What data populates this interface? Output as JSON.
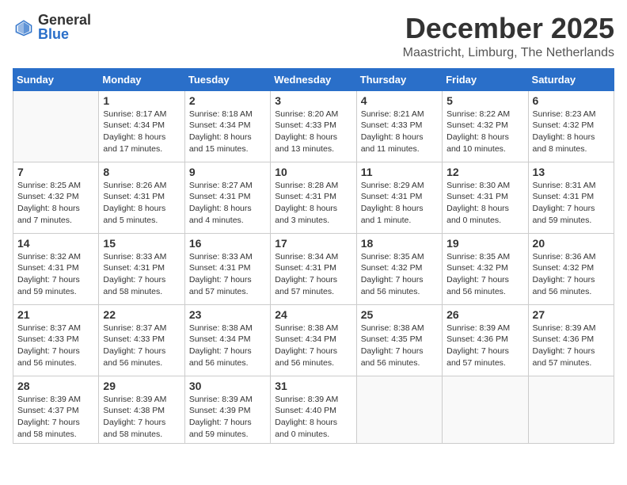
{
  "logo": {
    "general": "General",
    "blue": "Blue"
  },
  "title": "December 2025",
  "location": "Maastricht, Limburg, The Netherlands",
  "weekdays": [
    "Sunday",
    "Monday",
    "Tuesday",
    "Wednesday",
    "Thursday",
    "Friday",
    "Saturday"
  ],
  "weeks": [
    [
      {
        "day": "",
        "info": ""
      },
      {
        "day": "1",
        "info": "Sunrise: 8:17 AM\nSunset: 4:34 PM\nDaylight: 8 hours\nand 17 minutes."
      },
      {
        "day": "2",
        "info": "Sunrise: 8:18 AM\nSunset: 4:34 PM\nDaylight: 8 hours\nand 15 minutes."
      },
      {
        "day": "3",
        "info": "Sunrise: 8:20 AM\nSunset: 4:33 PM\nDaylight: 8 hours\nand 13 minutes."
      },
      {
        "day": "4",
        "info": "Sunrise: 8:21 AM\nSunset: 4:33 PM\nDaylight: 8 hours\nand 11 minutes."
      },
      {
        "day": "5",
        "info": "Sunrise: 8:22 AM\nSunset: 4:32 PM\nDaylight: 8 hours\nand 10 minutes."
      },
      {
        "day": "6",
        "info": "Sunrise: 8:23 AM\nSunset: 4:32 PM\nDaylight: 8 hours\nand 8 minutes."
      }
    ],
    [
      {
        "day": "7",
        "info": "Sunrise: 8:25 AM\nSunset: 4:32 PM\nDaylight: 8 hours\nand 7 minutes."
      },
      {
        "day": "8",
        "info": "Sunrise: 8:26 AM\nSunset: 4:31 PM\nDaylight: 8 hours\nand 5 minutes."
      },
      {
        "day": "9",
        "info": "Sunrise: 8:27 AM\nSunset: 4:31 PM\nDaylight: 8 hours\nand 4 minutes."
      },
      {
        "day": "10",
        "info": "Sunrise: 8:28 AM\nSunset: 4:31 PM\nDaylight: 8 hours\nand 3 minutes."
      },
      {
        "day": "11",
        "info": "Sunrise: 8:29 AM\nSunset: 4:31 PM\nDaylight: 8 hours\nand 1 minute."
      },
      {
        "day": "12",
        "info": "Sunrise: 8:30 AM\nSunset: 4:31 PM\nDaylight: 8 hours\nand 0 minutes."
      },
      {
        "day": "13",
        "info": "Sunrise: 8:31 AM\nSunset: 4:31 PM\nDaylight: 7 hours\nand 59 minutes."
      }
    ],
    [
      {
        "day": "14",
        "info": "Sunrise: 8:32 AM\nSunset: 4:31 PM\nDaylight: 7 hours\nand 59 minutes."
      },
      {
        "day": "15",
        "info": "Sunrise: 8:33 AM\nSunset: 4:31 PM\nDaylight: 7 hours\nand 58 minutes."
      },
      {
        "day": "16",
        "info": "Sunrise: 8:33 AM\nSunset: 4:31 PM\nDaylight: 7 hours\nand 57 minutes."
      },
      {
        "day": "17",
        "info": "Sunrise: 8:34 AM\nSunset: 4:31 PM\nDaylight: 7 hours\nand 57 minutes."
      },
      {
        "day": "18",
        "info": "Sunrise: 8:35 AM\nSunset: 4:32 PM\nDaylight: 7 hours\nand 56 minutes."
      },
      {
        "day": "19",
        "info": "Sunrise: 8:35 AM\nSunset: 4:32 PM\nDaylight: 7 hours\nand 56 minutes."
      },
      {
        "day": "20",
        "info": "Sunrise: 8:36 AM\nSunset: 4:32 PM\nDaylight: 7 hours\nand 56 minutes."
      }
    ],
    [
      {
        "day": "21",
        "info": "Sunrise: 8:37 AM\nSunset: 4:33 PM\nDaylight: 7 hours\nand 56 minutes."
      },
      {
        "day": "22",
        "info": "Sunrise: 8:37 AM\nSunset: 4:33 PM\nDaylight: 7 hours\nand 56 minutes."
      },
      {
        "day": "23",
        "info": "Sunrise: 8:38 AM\nSunset: 4:34 PM\nDaylight: 7 hours\nand 56 minutes."
      },
      {
        "day": "24",
        "info": "Sunrise: 8:38 AM\nSunset: 4:34 PM\nDaylight: 7 hours\nand 56 minutes."
      },
      {
        "day": "25",
        "info": "Sunrise: 8:38 AM\nSunset: 4:35 PM\nDaylight: 7 hours\nand 56 minutes."
      },
      {
        "day": "26",
        "info": "Sunrise: 8:39 AM\nSunset: 4:36 PM\nDaylight: 7 hours\nand 57 minutes."
      },
      {
        "day": "27",
        "info": "Sunrise: 8:39 AM\nSunset: 4:36 PM\nDaylight: 7 hours\nand 57 minutes."
      }
    ],
    [
      {
        "day": "28",
        "info": "Sunrise: 8:39 AM\nSunset: 4:37 PM\nDaylight: 7 hours\nand 58 minutes."
      },
      {
        "day": "29",
        "info": "Sunrise: 8:39 AM\nSunset: 4:38 PM\nDaylight: 7 hours\nand 58 minutes."
      },
      {
        "day": "30",
        "info": "Sunrise: 8:39 AM\nSunset: 4:39 PM\nDaylight: 7 hours\nand 59 minutes."
      },
      {
        "day": "31",
        "info": "Sunrise: 8:39 AM\nSunset: 4:40 PM\nDaylight: 8 hours\nand 0 minutes."
      },
      {
        "day": "",
        "info": ""
      },
      {
        "day": "",
        "info": ""
      },
      {
        "day": "",
        "info": ""
      }
    ]
  ]
}
